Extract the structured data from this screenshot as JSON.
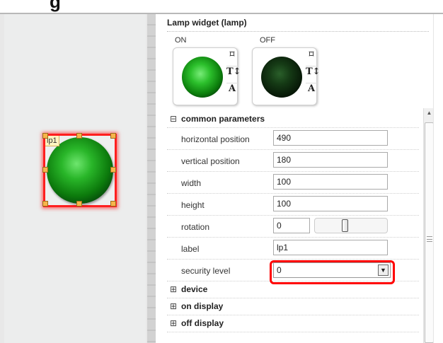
{
  "header": {
    "title_fragment": "g"
  },
  "canvas": {
    "widget_label": "lp1"
  },
  "panel": {
    "title": "Lamp widget (lamp)",
    "previews": [
      {
        "label": "ON",
        "state": "on",
        "icons": [
          "crop-icon",
          "text-format-icon",
          "font-icon"
        ]
      },
      {
        "label": "OFF",
        "state": "off",
        "icons": [
          "crop-icon",
          "text-format-icon",
          "font-icon"
        ]
      }
    ],
    "tool_glyphs": {
      "crop": "⌑",
      "text_format": "T↕",
      "font": "A"
    },
    "sections": {
      "common": {
        "toggle": "⊟",
        "label": "common parameters"
      },
      "device": {
        "toggle": "⊞",
        "label": "device"
      },
      "on_display": {
        "toggle": "⊞",
        "label": "on display"
      },
      "off_display": {
        "toggle": "⊞",
        "label": "off display"
      }
    },
    "properties": {
      "horizontal_position": {
        "label": "horizontal position",
        "value": "490"
      },
      "vertical_position": {
        "label": "vertical position",
        "value": "180"
      },
      "width": {
        "label": "width",
        "value": "100"
      },
      "height": {
        "label": "height",
        "value": "100"
      },
      "rotation": {
        "label": "rotation",
        "value": "0"
      },
      "label": {
        "label": "label",
        "value": "lp1"
      },
      "security_level": {
        "label": "security level",
        "value": "0"
      }
    }
  },
  "colors": {
    "selection": "#ff1f1f",
    "highlight": "#ff0000",
    "lamp_on": "#2cc02c",
    "lamp_off": "#0a1f0a",
    "handle": "#f7b54a"
  }
}
